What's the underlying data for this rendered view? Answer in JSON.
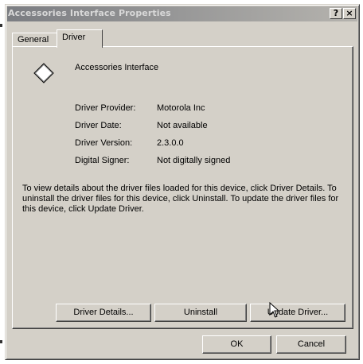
{
  "window": {
    "title": "Accessories Interface Properties",
    "help_button": "?",
    "close_button": "×"
  },
  "tabs": [
    {
      "label": "General",
      "selected": false
    },
    {
      "label": "Driver",
      "selected": true
    }
  ],
  "device": {
    "name": "Accessories Interface",
    "icon": "diamond-device-icon"
  },
  "properties": [
    {
      "label": "Driver Provider:",
      "value": "Motorola Inc"
    },
    {
      "label": "Driver Date:",
      "value": "Not available"
    },
    {
      "label": "Driver Version:",
      "value": "2.3.0.0"
    },
    {
      "label": "Digital Signer:",
      "value": "Not digitally signed"
    }
  ],
  "description": "To view details about the driver files loaded for this device, click Driver Details. To uninstall the driver files for this device, click Uninstall. To update the driver files for this device, click Update Driver.",
  "actions": {
    "driver_details": "Driver Details...",
    "uninstall": "Uninstall",
    "update_driver": "Update Driver..."
  },
  "footer": {
    "ok": "OK",
    "cancel": "Cancel"
  },
  "colors": {
    "face": "#d4d0c8",
    "titlebar_inactive_start": "#7b7d82",
    "titlebar_inactive_end": "#b5b3ae"
  }
}
